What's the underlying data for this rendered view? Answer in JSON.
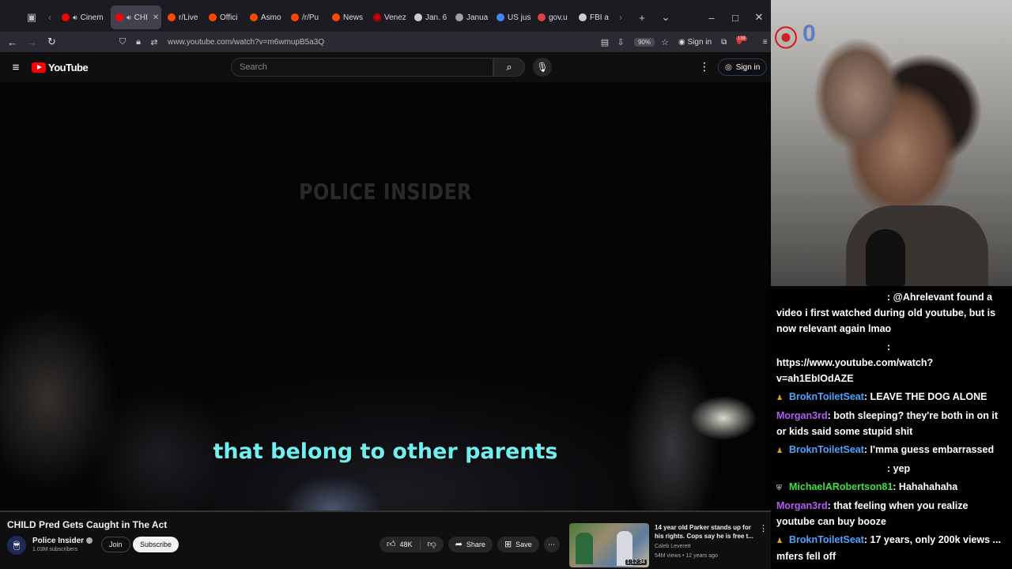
{
  "browser": {
    "tabs": [
      {
        "label": "Cinem",
        "color": "#ff0000",
        "audio": true,
        "active": false
      },
      {
        "label": "CHI",
        "color": "#ff0000",
        "audio": true,
        "active": true
      },
      {
        "label": "r/Live",
        "color": "#ff4500",
        "audio": false,
        "active": false
      },
      {
        "label": "Offici",
        "color": "#ff4500",
        "audio": false,
        "active": false
      },
      {
        "label": "Asmo",
        "color": "#ff4500",
        "audio": false,
        "active": false
      },
      {
        "label": "/r/Pu",
        "color": "#ff4500",
        "audio": false,
        "active": false
      },
      {
        "label": "News",
        "color": "#ff4500",
        "audio": false,
        "active": false
      },
      {
        "label": "Venez",
        "color": "#bb0000",
        "audio": false,
        "active": false
      },
      {
        "label": "Jan. 6",
        "color": "#cccccc",
        "audio": false,
        "active": false
      },
      {
        "label": "Janua",
        "color": "#9aa0a6",
        "audio": false,
        "active": false
      },
      {
        "label": "US jus",
        "color": "#4285f4",
        "audio": false,
        "active": false
      },
      {
        "label": "gov.u",
        "color": "#e04040",
        "audio": false,
        "active": false
      },
      {
        "label": "FBI a",
        "color": "#cccccc",
        "audio": false,
        "active": false
      }
    ],
    "url": "www.youtube.com/watch?v=m6wmupB5a3Q",
    "zoom": "90%",
    "signin_label": "Sign in",
    "extension_badge": "139"
  },
  "youtube": {
    "logo_text": "YouTube",
    "search_placeholder": "Search",
    "signin_label": "Sign in",
    "accent": "#ff0000"
  },
  "video": {
    "watermark": "POLICE INSIDER",
    "subtitle": "that belong to other parents",
    "subtitle_color": "#6ff0ee",
    "title": "CHILD Pred Gets Caught in The Act",
    "channel": "Police Insider",
    "subscribers": "1.03M subscribers",
    "join_label": "Join",
    "subscribe_label": "Subscribe",
    "likes": "48K",
    "share_label": "Share",
    "save_label": "Save"
  },
  "recommendation": {
    "title": "14 year old Parker stands up for his rights. Cops say he is free t...",
    "channel": "Caleb Leverett",
    "meta": "54M views • 12 years ago",
    "duration": "1:12:34"
  },
  "chat": {
    "messages": [
      {
        "user": "",
        "user_color": "#ffffff",
        "badge": "",
        "text": ": @Ahrelevant found a video i first watched during old youtube, but is now relevant again lmao"
      },
      {
        "user": "",
        "user_color": "#ffffff",
        "badge": "",
        "text": ": https://www.youtube.com/watch?v=ah1EbIOdAZE"
      },
      {
        "user": "BroknToiletSeat",
        "user_color": "#4fa3ff",
        "badge": "sub",
        "text": ": LEAVE THE DOG ALONE"
      },
      {
        "user": "Morgan3rd",
        "user_color": "#b45cf0",
        "badge": "",
        "text": ": both sleeping? they're both in on it or kids said some stupid shit"
      },
      {
        "user": "BroknToiletSeat",
        "user_color": "#4fa3ff",
        "badge": "sub",
        "text": ": I'mma guess embarrassed"
      },
      {
        "user": "",
        "user_color": "#ffffff",
        "badge": "",
        "text": ": yep"
      },
      {
        "user": "MichaelARobertson81",
        "user_color": "#3ee03e",
        "badge": "mod",
        "text": ": Hahahahaha"
      },
      {
        "user": "Morgan3rd",
        "user_color": "#b45cf0",
        "badge": "",
        "text": ": that feeling when you realize youtube can buy booze"
      },
      {
        "user": "BroknToiletSeat",
        "user_color": "#4fa3ff",
        "badge": "sub",
        "text": ": 17 years, only 200k views ... mfers fell off"
      }
    ]
  }
}
